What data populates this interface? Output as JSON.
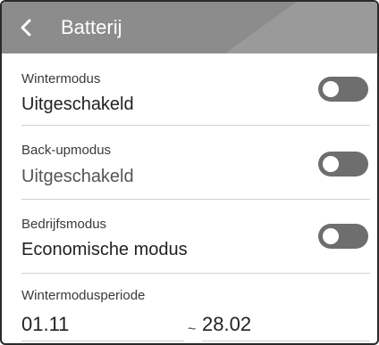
{
  "header": {
    "title": "Batterij",
    "background_color": "#8c8c8c",
    "back_icon": "chevron-left-icon"
  },
  "settings": [
    {
      "label": "Wintermodus",
      "value": "Uitgeschakeld",
      "toggle_on": false
    },
    {
      "label": "Back-upmodus",
      "value": "Uitgeschakeld",
      "toggle_on": false
    },
    {
      "label": "Bedrijfsmodus",
      "value": "Economische modus",
      "toggle_on": false
    }
  ],
  "winter_period": {
    "label": "Wintermodusperiode",
    "start": "01.11",
    "separator": "~",
    "end": "28.02"
  },
  "colors": {
    "toggle_off": "#6e6e6e",
    "divider": "#cfcfcf"
  }
}
